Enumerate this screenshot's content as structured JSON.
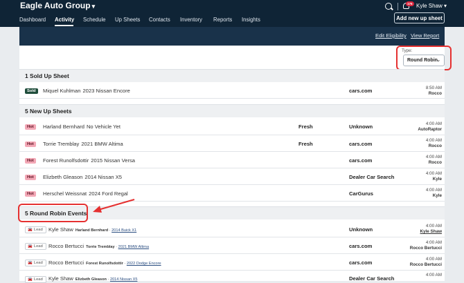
{
  "header": {
    "brand": "Eagle Auto Group",
    "nav": [
      "Dashboard",
      "Activity",
      "Schedule",
      "Up Sheets",
      "Contacts",
      "Inventory",
      "Reports",
      "Insights"
    ],
    "active_nav": "Activity",
    "notif_count": "176",
    "user": "Kyle Shaw",
    "add_button": "Add new up sheet"
  },
  "subbar": {
    "edit_eligibility": "Edit Eligibility",
    "view_report": "View Report"
  },
  "filter": {
    "label": "Type:",
    "value": "Round Robin"
  },
  "sections": {
    "sold": {
      "title": "1 Sold Up Sheet"
    },
    "new": {
      "title": "5 New Up Sheets"
    },
    "rr": {
      "title": "5 Round Robin Events"
    }
  },
  "sold_rows": [
    {
      "badge": "Sold",
      "name": "Miquel Kuhlman",
      "vehicle": "2023 Nissan Encore",
      "status": "",
      "source": "cars.com",
      "time": "8:50 AM",
      "who": "Rocco"
    }
  ],
  "new_rows": [
    {
      "badge": "Hot",
      "name": "Harland Bernhard",
      "vehicle": "No Vehicle Yet",
      "status": "Fresh",
      "source": "Unknown",
      "time": "4:00 AM",
      "who": "AutoRaptor"
    },
    {
      "badge": "Hot",
      "name": "Torrie Tremblay",
      "vehicle": "2021 BMW Altima",
      "status": "Fresh",
      "source": "cars.com",
      "time": "4:00 AM",
      "who": "Rocco"
    },
    {
      "badge": "Hot",
      "name": "Forest Runolfsdottir",
      "vehicle": "2015 Nissan Versa",
      "status": "",
      "source": "cars.com",
      "time": "4:00 AM",
      "who": "Rocco"
    },
    {
      "badge": "Hot",
      "name": "Elizbeth Gleason",
      "vehicle": "2014 Nissan X5",
      "status": "",
      "source": "Dealer Car Search",
      "time": "4:00 AM",
      "who": "Kyle"
    },
    {
      "badge": "Hot",
      "name": "Herschel Weissnat",
      "vehicle": "2024 Ford Regal",
      "status": "",
      "source": "CarGurus",
      "time": "4:00 AM",
      "who": "Kyle"
    }
  ],
  "rr_rows": [
    {
      "badge": "Lead",
      "agent": "Kyle Shaw",
      "customer": "Harland Bernhard",
      "vehicle": "2014 Buick X1",
      "source": "Unknown",
      "time": "4:00 AM",
      "who": "Kyle Shaw"
    },
    {
      "badge": "Lead",
      "agent": "Rocco Bertucci",
      "customer": "Torrie Tremblay",
      "vehicle": "2021 BMW Altima",
      "source": "cars.com",
      "time": "4:00 AM",
      "who": "Rocco Bertucci"
    },
    {
      "badge": "Lead",
      "agent": "Rocco Bertucci",
      "customer": "Forest Runolfsdottir",
      "vehicle": "2022 Dodge Encore",
      "source": "cars.com",
      "time": "4:00 AM",
      "who": "Rocco Bertucci"
    },
    {
      "badge": "Lead",
      "agent": "Kyle Shaw",
      "customer": "Elizbeth Gleason",
      "vehicle": "2014 Nissan X5",
      "source": "Dealer Car Search",
      "time": "4:00 AM",
      "who": ""
    }
  ],
  "colors": {
    "nav_bg": "#0f2436",
    "subbar_bg": "#19324a",
    "highlight": "#e53030",
    "hot_badge": "#f3a8b6",
    "sold_badge": "#1f4d3b"
  }
}
